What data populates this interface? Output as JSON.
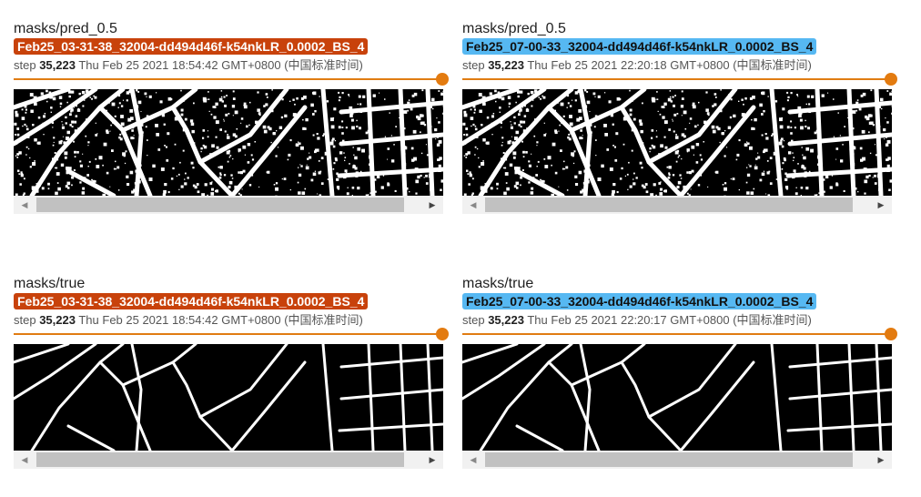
{
  "cards": [
    {
      "tag": "masks/pred_0.5",
      "run": "Feb25_03-31-38_32004-dd494d46f-k54nkLR_0.0002_BS_4",
      "step_label": "step",
      "step": "35,223",
      "time": "Thu Feb 25 2021 18:54:42 GMT+0800 (中国标准时间)",
      "run_color": "#c8420b"
    },
    {
      "tag": "masks/pred_0.5",
      "run": "Feb25_07-00-33_32004-dd494d46f-k54nkLR_0.0002_BS_4",
      "step_label": "step",
      "step": "35,223",
      "time": "Thu Feb 25 2021 22:20:18 GMT+0800 (中国标准时间)",
      "run_color": "#56b8f2"
    },
    {
      "tag": "masks/true",
      "run": "Feb25_03-31-38_32004-dd494d46f-k54nkLR_0.0002_BS_4",
      "step_label": "step",
      "step": "35,223",
      "time": "Thu Feb 25 2021 18:54:42 GMT+0800 (中国标准时间)",
      "run_color": "#c8420b"
    },
    {
      "tag": "masks/true",
      "run": "Feb25_07-00-33_32004-dd494d46f-k54nkLR_0.0002_BS_4",
      "step_label": "step",
      "step": "35,223",
      "time": "Thu Feb 25 2021 22:20:17 GMT+0800 (中国标准时间)",
      "run_color": "#56b8f2"
    }
  ],
  "slider_value": 1.0,
  "accent_color": "#e07c12"
}
